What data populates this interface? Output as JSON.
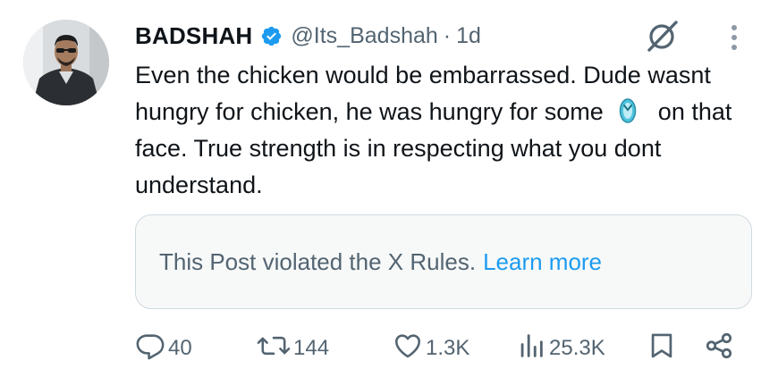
{
  "tweet": {
    "author_name": "BADSHAH",
    "handle": "@Its_Badshah",
    "separator": "·",
    "time": "1d",
    "text_part1": "Even the chicken would be embarrassed. Dude wasnt hungry for chicken, he was hungry for some",
    "text_part2": "on that face. True strength is in respecting what you dont understand.",
    "inline_emoji": "flip-flop-icon"
  },
  "notice": {
    "text": "This Post violated the X Rules.",
    "link": "Learn more"
  },
  "actions": {
    "replies": "40",
    "reposts": "144",
    "likes": "1.3K",
    "views": "25.3K"
  },
  "colors": {
    "text": "#0f1419",
    "secondary": "#536471",
    "accent": "#1d9bf0",
    "border": "#cfd9de",
    "notice_bg": "#f7f9f9"
  },
  "icons": {
    "verified": "verified-badge-icon",
    "grok": "grok-icon",
    "more": "more-vertical-icon",
    "reply": "reply-icon",
    "repost": "repost-icon",
    "like": "like-icon",
    "views": "views-icon",
    "bookmark": "bookmark-icon",
    "share": "share-icon"
  }
}
